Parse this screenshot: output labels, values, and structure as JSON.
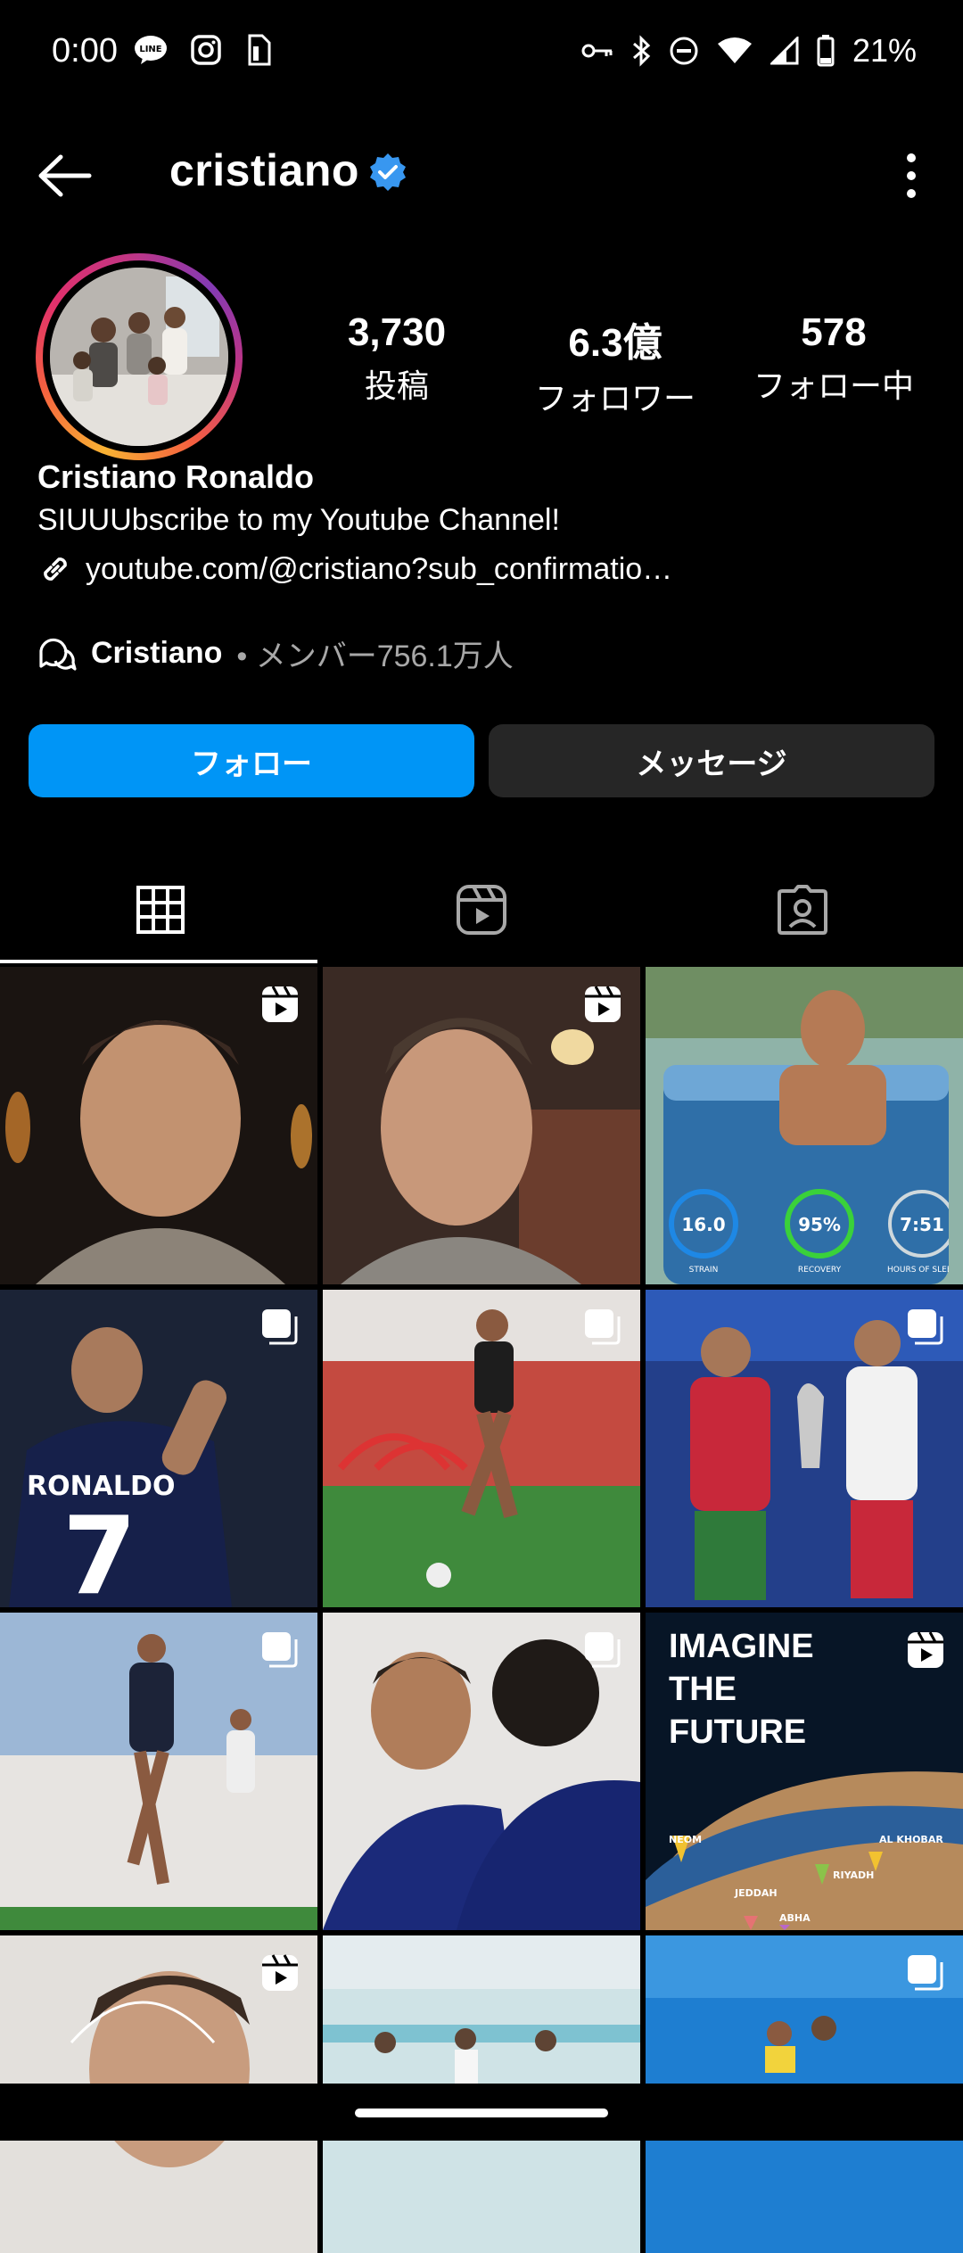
{
  "status_bar": {
    "time": "0:00",
    "battery_percent": "21%",
    "left_icons": [
      "line-icon",
      "instagram-icon",
      "sim-icon"
    ],
    "right_icons": [
      "key-icon",
      "bluetooth-icon",
      "do-not-disturb-icon",
      "wifi-icon",
      "signal-icon",
      "battery-icon"
    ]
  },
  "header": {
    "username": "cristiano",
    "verified": true
  },
  "profile": {
    "stats": [
      {
        "value": "3,730",
        "label": "投稿"
      },
      {
        "value": "6.3億",
        "label": "フォロワー"
      },
      {
        "value": "578",
        "label": "フォロー中"
      }
    ],
    "name": "Cristiano Ronaldo",
    "bio": "SIUUUbscribe to my Youtube Channel!",
    "link": "youtube.com/@cristiano?sub_confirmatio…",
    "channel": {
      "name": "Cristiano",
      "meta": "• メンバー756.1万人"
    }
  },
  "actions": {
    "follow_label": "フォロー",
    "message_label": "メッセージ"
  },
  "tabs": [
    "grid-icon",
    "reels-icon",
    "tagged-icon"
  ],
  "grid": {
    "posts": [
      {
        "type": "reel",
        "overlay": ""
      },
      {
        "type": "reel",
        "overlay": ""
      },
      {
        "type": "photo",
        "overlay": "",
        "stats": [
          "16.0",
          "95%",
          "7:51"
        ],
        "stat_labels": [
          "STRAIN",
          "RECOVERY",
          "HOURS OF SLEEP"
        ]
      },
      {
        "type": "carousel",
        "overlay": ""
      },
      {
        "type": "carousel",
        "overlay": ""
      },
      {
        "type": "carousel",
        "overlay": ""
      },
      {
        "type": "carousel",
        "overlay": ""
      },
      {
        "type": "carousel",
        "overlay": ""
      },
      {
        "type": "reel",
        "overlay": "IMAGINE THE FUTURE",
        "map_labels": [
          "NEOM",
          "AL KHOBAR",
          "RIYADH",
          "JEDDAH",
          "ABHA"
        ]
      },
      {
        "type": "reel",
        "overlay": ""
      },
      {
        "type": "photo",
        "overlay": ""
      },
      {
        "type": "carousel",
        "overlay": ""
      }
    ]
  },
  "colors": {
    "follow_button": "#0095f6",
    "message_button": "#262626",
    "verified_badge": "#3897f0"
  }
}
